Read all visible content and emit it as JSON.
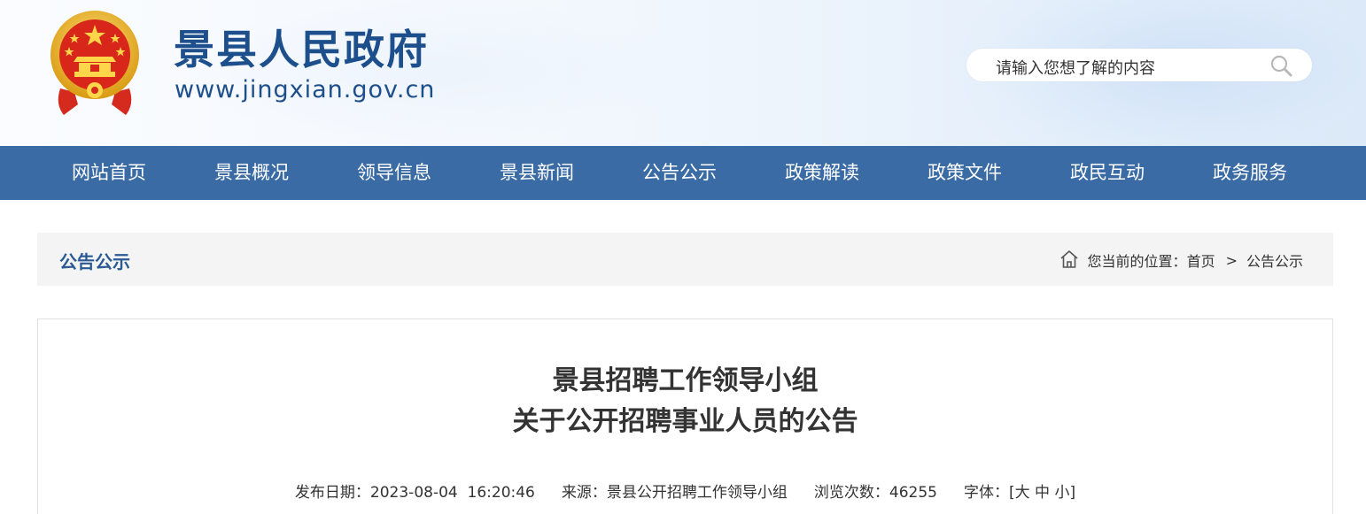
{
  "header": {
    "site_title": "景县人民政府",
    "site_url": "www.jingxian.gov.cn",
    "search": {
      "placeholder": "请输入您想了解的内容"
    }
  },
  "nav": {
    "items": [
      "网站首页",
      "景县概况",
      "领导信息",
      "景县新闻",
      "公告公示",
      "政策解读",
      "政策文件",
      "政民互动",
      "政务服务"
    ]
  },
  "breadcrumb": {
    "section_title": "公告公示",
    "location_label": "您当前的位置：",
    "home": "首页",
    "separator": ">",
    "current": "公告公示"
  },
  "article": {
    "title_line1": "景县招聘工作领导小组",
    "title_line2": "关于公开招聘事业人员的公告",
    "meta": {
      "date_label": "发布日期：",
      "date": "2023-08-04  16:20:46",
      "source_label": "来源：",
      "source": "景县公开招聘工作领导小组",
      "views_label": "浏览次数：",
      "views": "46255",
      "font_label": "字体：",
      "font_open": "[",
      "font_large": "大",
      "font_medium": "中",
      "font_small": "小",
      "font_close": "]"
    }
  },
  "colors": {
    "nav_bg": "#3a6ba5",
    "brand_blue": "#1d4f8c",
    "crumb_title": "#2a5a94"
  }
}
